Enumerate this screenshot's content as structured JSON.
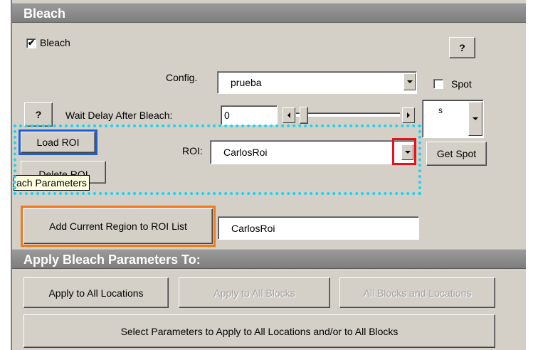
{
  "bleach_section": {
    "header": "Bleach",
    "bleach_checkbox_label": "Bleach",
    "bleach_checked": true,
    "help_label": "?",
    "config_label": "Config.",
    "config_value": "prueba",
    "spot_label": "Spot",
    "spot_checked": false,
    "help2_label": "?",
    "wait_delay_label": "Wait Delay After Bleach:",
    "wait_delay_value": "0",
    "wait_unit_value": "s",
    "load_roi_label": "Load ROI",
    "delete_roi_label": "Delete ROI",
    "tooltip_text": "ach Parameters",
    "roi_label": "ROI:",
    "roi_value": "CarlosRoi",
    "get_spot_label": "Get Spot",
    "add_region_label": "Add Current Region to ROI List",
    "region_name_value": "CarlosRoi"
  },
  "apply_section": {
    "header": "Apply Bleach Parameters To:",
    "apply_all_locations": "Apply to All Locations",
    "apply_all_blocks": "Apply to All Blocks",
    "all_blocks_and_locations": "All Blocks and Locations",
    "select_parameters": "Select Parameters to Apply to All Locations and/or to All Blocks"
  },
  "annotations": {
    "load_roi_box_color": "#1e5fd8",
    "dropdown_box_color": "#e8101a",
    "add_region_box_color": "#f07a1c",
    "dotted_region_color": "#19d5ef"
  }
}
